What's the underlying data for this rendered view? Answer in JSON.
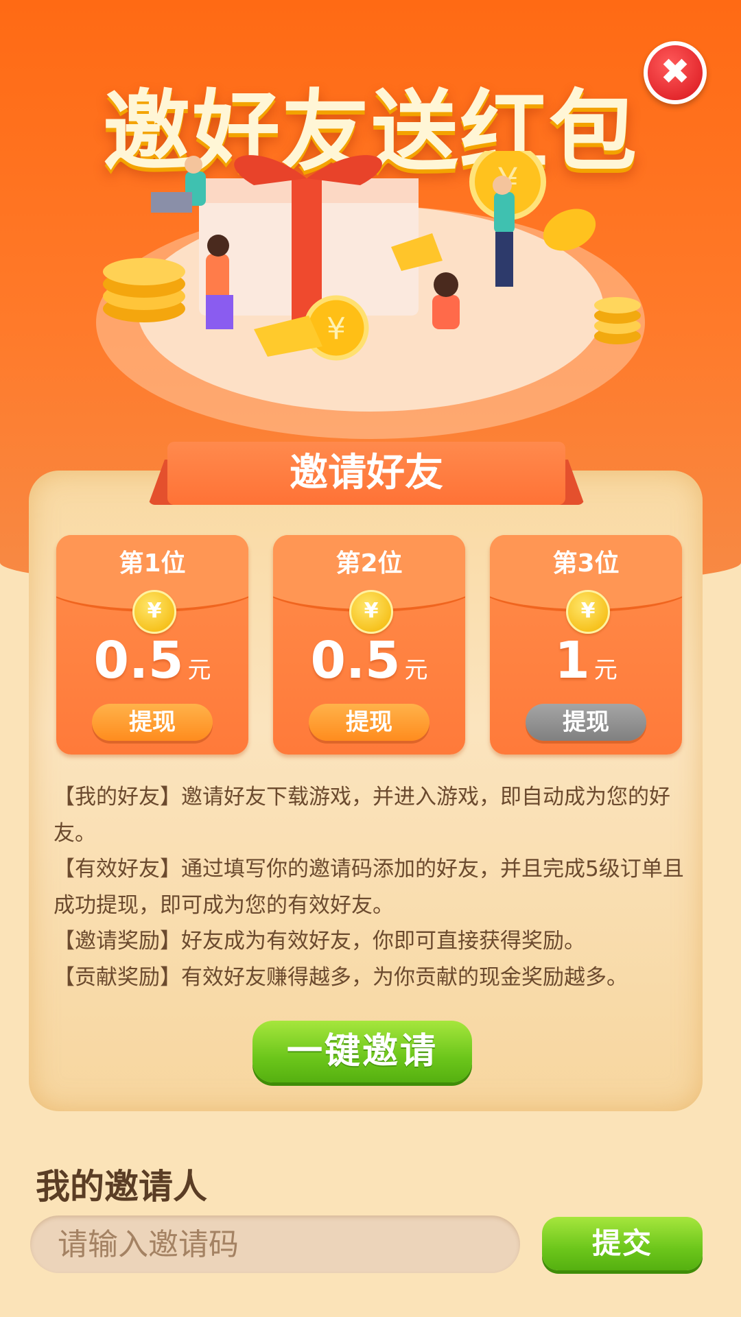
{
  "header": {
    "title": "邀好友送红包"
  },
  "close_icon_glyph": "✖",
  "section": {
    "ribbon_label": "邀请好友"
  },
  "rewards": [
    {
      "rank": "第1位",
      "amount": "0.5",
      "unit": "元",
      "button": "提现",
      "button_state": "orange"
    },
    {
      "rank": "第2位",
      "amount": "0.5",
      "unit": "元",
      "button": "提现",
      "button_state": "orange"
    },
    {
      "rank": "第3位",
      "amount": "1",
      "unit": "元",
      "button": "提现",
      "button_state": "gray"
    }
  ],
  "coin_glyph": "¥",
  "rules": [
    "【我的好友】邀请好友下载游戏，并进入游戏，即自动成为您的好友。",
    "【有效好友】通过填写你的邀请码添加的好友，并且完成5级订单且成功提现，即可成为您的有效好友。",
    "【邀请奖励】好友成为有效好友，你即可直接获得奖励。",
    "【贡献奖励】有效好友赚得越多，为你贡献的现金奖励越多。"
  ],
  "invite_button": "一键邀请",
  "inviter": {
    "title": "我的邀请人",
    "placeholder": "请输入邀请码",
    "submit": "提交"
  },
  "colors": {
    "header_orange": "#ff6a14",
    "panel_cream": "#fbe3b8",
    "card_orange": "#ff7a3a",
    "button_green": "#6cc61b",
    "text_brown": "#6b4a2e"
  }
}
